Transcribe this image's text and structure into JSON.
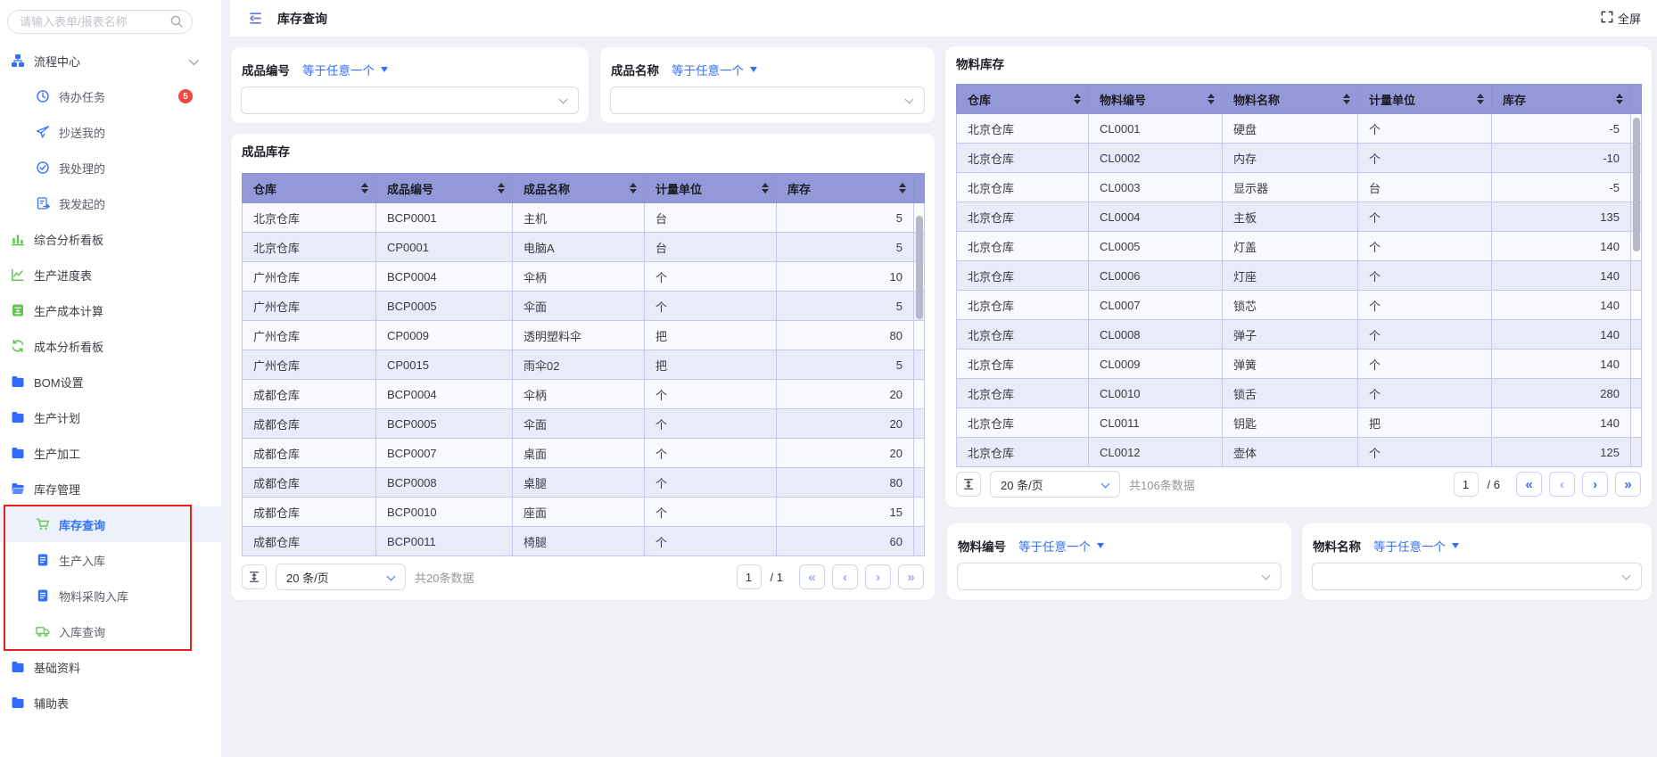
{
  "app": {
    "title": "库存查询",
    "fullscreen_label": "全屏"
  },
  "colors": {
    "accent": "#3370ff",
    "table_header_bg": "#9298d8",
    "row_stripe": "#e9ebf8",
    "badge_red": "#f2483f",
    "annotation_red": "#e3201d",
    "icon_green": "#62c554"
  },
  "sidebar": {
    "search_placeholder": "请输入表单/报表名称",
    "items": [
      {
        "label": "流程中心",
        "icon": "flow-icon",
        "level": 0,
        "chevron": true
      },
      {
        "label": "待办任务",
        "icon": "clock-icon",
        "level": 1,
        "badge": "5"
      },
      {
        "label": "抄送我的",
        "icon": "send-icon",
        "level": 1
      },
      {
        "label": "我处理的",
        "icon": "check-circle-icon",
        "level": 1
      },
      {
        "label": "我发起的",
        "icon": "doc-arrow-icon",
        "level": 1
      },
      {
        "label": "综合分析看板",
        "icon": "bar-chart-icon",
        "level": 0
      },
      {
        "label": "生产进度表",
        "icon": "line-chart-icon",
        "level": 0
      },
      {
        "label": "生产成本计算",
        "icon": "calculator-icon",
        "level": 0
      },
      {
        "label": "成本分析看板",
        "icon": "cost-analysis-icon",
        "level": 0
      },
      {
        "label": "BOM设置",
        "icon": "folder-icon",
        "level": 0
      },
      {
        "label": "生产计划",
        "icon": "folder-icon",
        "level": 0
      },
      {
        "label": "生产加工",
        "icon": "folder-icon",
        "level": 0
      },
      {
        "label": "库存管理",
        "icon": "folder-open-icon",
        "level": 0
      },
      {
        "label": "库存查询",
        "icon": "cart-icon",
        "level": 1,
        "selected": true
      },
      {
        "label": "生产入库",
        "icon": "doc-icon",
        "level": 1
      },
      {
        "label": "物料采购入库",
        "icon": "doc-icon",
        "level": 1
      },
      {
        "label": "入库查询",
        "icon": "truck-icon",
        "level": 1
      },
      {
        "label": "基础资料",
        "icon": "folder-icon",
        "level": 0
      },
      {
        "label": "辅助表",
        "icon": "folder-icon",
        "level": 0
      }
    ]
  },
  "filters": {
    "product_code": {
      "label": "成品编号",
      "op": "等于任意一个"
    },
    "product_name": {
      "label": "成品名称",
      "op": "等于任意一个"
    },
    "material_code": {
      "label": "物料编号",
      "op": "等于任意一个"
    },
    "material_name": {
      "label": "物料名称",
      "op": "等于任意一个"
    }
  },
  "finished_table": {
    "title": "成品库存",
    "columns": [
      "仓库",
      "成品编号",
      "成品名称",
      "计量单位",
      "库存"
    ],
    "rows": [
      [
        "北京仓库",
        "BCP0001",
        "主机",
        "台",
        "5"
      ],
      [
        "北京仓库",
        "CP0001",
        "电脑A",
        "台",
        "5"
      ],
      [
        "广州仓库",
        "BCP0004",
        "伞柄",
        "个",
        "10"
      ],
      [
        "广州仓库",
        "BCP0005",
        "伞面",
        "个",
        "5"
      ],
      [
        "广州仓库",
        "CP0009",
        "透明塑料伞",
        "把",
        "80"
      ],
      [
        "广州仓库",
        "CP0015",
        "雨伞02",
        "把",
        "5"
      ],
      [
        "成都仓库",
        "BCP0004",
        "伞柄",
        "个",
        "20"
      ],
      [
        "成都仓库",
        "BCP0005",
        "伞面",
        "个",
        "20"
      ],
      [
        "成都仓库",
        "BCP0007",
        "桌面",
        "个",
        "20"
      ],
      [
        "成都仓库",
        "BCP0008",
        "桌腿",
        "个",
        "80"
      ],
      [
        "成都仓库",
        "BCP0010",
        "座面",
        "个",
        "15"
      ],
      [
        "成都仓库",
        "BCP0011",
        "椅腿",
        "个",
        "60"
      ]
    ],
    "pagination": {
      "page_size": "20 条/页",
      "total": "共20条数据",
      "page": "1",
      "of": "/ 1",
      "nav_enabled": [
        false,
        false,
        false,
        false
      ]
    }
  },
  "material_table": {
    "title": "物料库存",
    "columns": [
      "仓库",
      "物料编号",
      "物料名称",
      "计量单位",
      "库存"
    ],
    "rows": [
      [
        "北京仓库",
        "CL0001",
        "硬盘",
        "个",
        "-5"
      ],
      [
        "北京仓库",
        "CL0002",
        "内存",
        "个",
        "-10"
      ],
      [
        "北京仓库",
        "CL0003",
        "显示器",
        "台",
        "-5"
      ],
      [
        "北京仓库",
        "CL0004",
        "主板",
        "个",
        "135"
      ],
      [
        "北京仓库",
        "CL0005",
        "灯盖",
        "个",
        "140"
      ],
      [
        "北京仓库",
        "CL0006",
        "灯座",
        "个",
        "140"
      ],
      [
        "北京仓库",
        "CL0007",
        "锁芯",
        "个",
        "140"
      ],
      [
        "北京仓库",
        "CL0008",
        "弹子",
        "个",
        "140"
      ],
      [
        "北京仓库",
        "CL0009",
        "弹簧",
        "个",
        "140"
      ],
      [
        "北京仓库",
        "CL0010",
        "锁舌",
        "个",
        "280"
      ],
      [
        "北京仓库",
        "CL0011",
        "钥匙",
        "把",
        "140"
      ],
      [
        "北京仓库",
        "CL0012",
        "壶体",
        "个",
        "125"
      ]
    ],
    "pagination": {
      "page_size": "20 条/页",
      "total": "共106条数据",
      "page": "1",
      "of": "/ 6",
      "nav_enabled": [
        true,
        false,
        true,
        true
      ]
    }
  }
}
